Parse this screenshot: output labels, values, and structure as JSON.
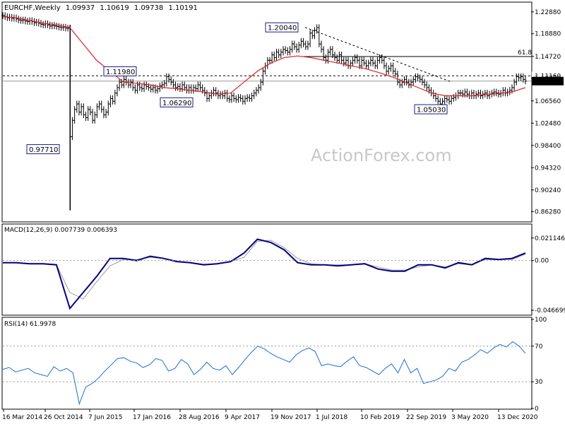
{
  "chart_data": {
    "type": "line",
    "title": "EURCHF,Weekly",
    "ohlc_readout": [
      "1.09937",
      "1.10619",
      "1.09738",
      "1.10191"
    ],
    "x_tick_labels": [
      "16 Mar 2014",
      "26 Oct 2014",
      "7 Jun 2015",
      "17 Jan 2016",
      "28 Aug 2016",
      "9 Apr 2017",
      "19 Nov 2017",
      "1 Jul 2018",
      "10 Feb 2019",
      "22 Sep 2019",
      "3 May 2020",
      "13 Dec 2020"
    ],
    "price_panel": {
      "ylim": [
        0.8451,
        1.2454
      ],
      "y_tick_labels": [
        "1.22880",
        "1.18880",
        "1.14720",
        "1.10720",
        "1.06560",
        "1.02480",
        "0.98400",
        "0.94320",
        "0.90240",
        "0.86280"
      ],
      "series": [
        {
          "kind": "candles_bars",
          "color": "#000000",
          "values": [
            1.222,
            1.22,
            1.218,
            1.219,
            1.217,
            1.218,
            1.216,
            1.214,
            1.213,
            1.214,
            1.212,
            1.211,
            1.213,
            1.211,
            1.209,
            1.21,
            1.208,
            1.206,
            1.205,
            1.207,
            1.205,
            1.203,
            1.204,
            1.203,
            1.202,
            1.201,
            1.2,
            1.201,
            1.199,
            1.199,
            1.0,
            1.03,
            1.05,
            1.06,
            1.045,
            1.055,
            1.04,
            1.035,
            1.05,
            1.045,
            1.03,
            1.04,
            1.055,
            1.06,
            1.05,
            1.04,
            1.045,
            1.06,
            1.07,
            1.065,
            1.08,
            1.09,
            1.1,
            1.095,
            1.105,
            1.1,
            1.095,
            1.1,
            1.09,
            1.085,
            1.095,
            1.09,
            1.088,
            1.095,
            1.092,
            1.09,
            1.087,
            1.09,
            1.085,
            1.088,
            1.093,
            1.095,
            1.098,
            1.11,
            1.105,
            1.1,
            1.095,
            1.09,
            1.092,
            1.088,
            1.095,
            1.09,
            1.085,
            1.09,
            1.085,
            1.09,
            1.088,
            1.095,
            1.09,
            1.085,
            1.08,
            1.07,
            1.075,
            1.08,
            1.085,
            1.08,
            1.075,
            1.078,
            1.075,
            1.08,
            1.07,
            1.068,
            1.075,
            1.07,
            1.068,
            1.072,
            1.07,
            1.065,
            1.07,
            1.072,
            1.07,
            1.075,
            1.08,
            1.085,
            1.09,
            1.1,
            1.12,
            1.13,
            1.14,
            1.14,
            1.15,
            1.145,
            1.155,
            1.15,
            1.155,
            1.16,
            1.158,
            1.155,
            1.16,
            1.17,
            1.165,
            1.16,
            1.168,
            1.175,
            1.17,
            1.165,
            1.17,
            1.19,
            1.185,
            1.195,
            1.2,
            1.17,
            1.16,
            1.145,
            1.14,
            1.155,
            1.16,
            1.15,
            1.145,
            1.14,
            1.15,
            1.14,
            1.135,
            1.14,
            1.13,
            1.135,
            1.14,
            1.145,
            1.14,
            1.13,
            1.14,
            1.135,
            1.13,
            1.135,
            1.14,
            1.135,
            1.13,
            1.14,
            1.145,
            1.14,
            1.13,
            1.12,
            1.125,
            1.13,
            1.12,
            1.115,
            1.1,
            1.095,
            1.1,
            1.105,
            1.1,
            1.095,
            1.1,
            1.105,
            1.11,
            1.108,
            1.105,
            1.1,
            1.095,
            1.09,
            1.085,
            1.08,
            1.075,
            1.07,
            1.065,
            1.06,
            1.065,
            1.07,
            1.068,
            1.065,
            1.07,
            1.072,
            1.075,
            1.08,
            1.08,
            1.078,
            1.082,
            1.078,
            1.075,
            1.08,
            1.075,
            1.078,
            1.08,
            1.075,
            1.078,
            1.08,
            1.075,
            1.078,
            1.08,
            1.082,
            1.08,
            1.078,
            1.08,
            1.085,
            1.08,
            1.082,
            1.085,
            1.09,
            1.1,
            1.11,
            1.108,
            1.11,
            1.105,
            1.1019
          ]
        },
        {
          "kind": "ma",
          "color": "#e0202a",
          "values": [
            1.22,
            1.218,
            1.213,
            1.208,
            1.205,
            1.2,
            1.17,
            1.14,
            1.12,
            1.1,
            1.098,
            1.095,
            1.09,
            1.088,
            1.085,
            1.082,
            1.078,
            1.08,
            1.1,
            1.12,
            1.135,
            1.145,
            1.148,
            1.145,
            1.14,
            1.135,
            1.13,
            1.125,
            1.118,
            1.11,
            1.1,
            1.09,
            1.08,
            1.075,
            1.075,
            1.075,
            1.077,
            1.079,
            1.082,
            1.09
          ]
        }
      ],
      "annotations": [
        {
          "label": "1.20040",
          "value": 1.2004
        },
        {
          "label": "1.11980",
          "value": 1.1198
        },
        {
          "label": "1.06290",
          "value": 1.0629
        },
        {
          "label": "0.97710",
          "value": 0.9771
        },
        {
          "label": "1.05030",
          "value": 1.0503
        }
      ],
      "levels": [
        {
          "label": "1.11160",
          "value": 1.1116,
          "style": "dashed",
          "color": "#000000"
        },
        {
          "label": "1.10191",
          "value": 1.10191,
          "style": "solid",
          "color": "#9a9a9a"
        },
        {
          "label": "61.8",
          "value": 1.147,
          "style": "solid",
          "color": "#000000"
        }
      ],
      "trendline": {
        "from": 1.2004,
        "to": 1.1,
        "style": "dashed"
      }
    },
    "macd_panel": {
      "title": "MACD(12,26,9) 0.007739 0.006393",
      "ylim": [
        -0.05,
        0.025
      ],
      "y_tick_labels": [
        "0.021146",
        "0.00",
        "-0.046699"
      ],
      "series": [
        {
          "name": "MACD",
          "color": "#000080",
          "values": [
            -0.002,
            -0.002,
            -0.003,
            -0.003,
            -0.004,
            -0.045,
            -0.03,
            -0.015,
            0.002,
            0.002,
            0.0,
            0.004,
            0.002,
            -0.001,
            -0.002,
            -0.004,
            -0.003,
            -0.001,
            0.007,
            0.02,
            0.017,
            0.01,
            -0.002,
            -0.004,
            -0.004,
            -0.005,
            -0.004,
            -0.003,
            -0.008,
            -0.01,
            -0.01,
            -0.004,
            -0.004,
            -0.007,
            -0.002,
            -0.004,
            0.002,
            0.001,
            0.002,
            0.007
          ]
        },
        {
          "name": "Signal",
          "color": "#9a9a9a",
          "values": [
            -0.002,
            -0.002,
            -0.003,
            -0.003,
            -0.004,
            -0.03,
            -0.036,
            -0.02,
            -0.005,
            0.001,
            0.001,
            0.003,
            0.002,
            -0.0005,
            -0.002,
            -0.0035,
            -0.003,
            -0.001,
            0.003,
            0.018,
            0.019,
            0.012,
            0.002,
            -0.003,
            -0.004,
            -0.004,
            -0.004,
            -0.003,
            -0.006,
            -0.009,
            -0.009,
            -0.006,
            -0.004,
            -0.006,
            -0.003,
            -0.004,
            0.001,
            0.001,
            0.001,
            0.006
          ]
        }
      ]
    },
    "rsi_panel": {
      "title": "RSI(14) 61.9978",
      "ylim": [
        0,
        100
      ],
      "y_tick_labels": [
        "100",
        "70",
        "30",
        "0"
      ],
      "levels": [
        70,
        30
      ],
      "series": [
        {
          "name": "RSI(14)",
          "color": "#1e6fd0",
          "values": [
            44,
            46,
            41,
            43,
            45,
            40,
            38,
            36,
            47,
            42,
            45,
            40,
            5,
            24,
            28,
            34,
            42,
            49,
            56,
            57,
            53,
            51,
            46,
            49,
            56,
            54,
            42,
            45,
            55,
            50,
            38,
            44,
            52,
            45,
            43,
            48,
            38,
            46,
            55,
            63,
            70,
            67,
            62,
            58,
            55,
            52,
            60,
            65,
            68,
            64,
            48,
            50,
            48,
            47,
            53,
            58,
            48,
            46,
            42,
            38,
            45,
            50,
            40,
            55,
            40,
            45,
            28,
            30,
            32,
            36,
            45,
            42,
            52,
            55,
            60,
            66,
            62,
            68,
            72,
            69,
            75,
            70,
            62
          ]
        }
      ]
    },
    "watermark": "ActionForex.com"
  }
}
